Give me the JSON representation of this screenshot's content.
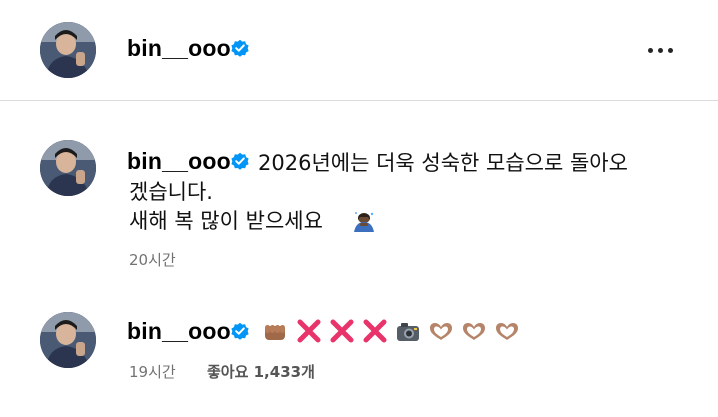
{
  "header": {
    "username": "bin__ooo",
    "verified_icon": "verified-badge-icon",
    "more_icon": "more-options-icon"
  },
  "post": {
    "username": "bin__ooo",
    "caption_line1": "2026년에는 더욱 성숙한 모습으로 돌아오",
    "caption_line2": "겠습니다.",
    "caption_line3": "새해 복 많이 받으세요",
    "caption_emoji": "person-bowing-emoji",
    "timestamp": "20시간"
  },
  "comment": {
    "username": "bin__ooo",
    "emojis": [
      "fist-emoji",
      "cross-mark-emoji",
      "cross-mark-emoji",
      "cross-mark-emoji",
      "camera-emoji",
      "heart-hands-emoji",
      "heart-hands-emoji",
      "heart-hands-emoji"
    ],
    "timestamp": "19시간",
    "likes_label": "좋아요 1,433개"
  },
  "colors": {
    "verified": "#0095f6",
    "meta_text": "#737373",
    "divider": "#dbdbdb",
    "cross": "#e8336b"
  }
}
